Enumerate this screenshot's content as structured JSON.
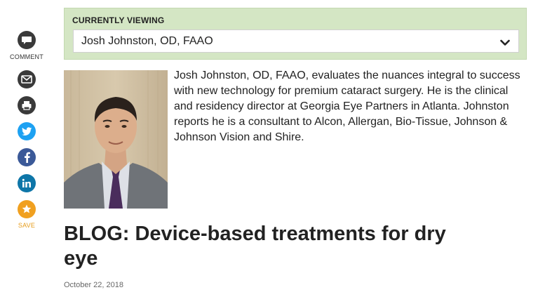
{
  "share_rail": {
    "comment_label": "COMMENT",
    "save_label": "SAVE",
    "icons": [
      "comment-icon",
      "email-icon",
      "print-icon",
      "twitter-icon",
      "facebook-icon",
      "linkedin-icon",
      "star-icon"
    ],
    "colors": {
      "dark": "#3a3a3a",
      "twitter": "#1da1f2",
      "facebook": "#3b5998",
      "linkedin": "#0e76a8",
      "save": "#f0a020"
    }
  },
  "currently_viewing": {
    "label": "CURRENTLY VIEWING",
    "selected": "Josh Johnston, OD, FAAO",
    "panel_color": "#d4e6c4"
  },
  "author": {
    "bio": "Josh Johnston, OD, FAAO, evaluates the nuances integral to success with new technology for premium cataract surgery. He is the clinical and residency director at Georgia Eye Partners in Atlanta. Johnston reports he is a consultant to Alcon, Allergan, Bio-Tissue, Johnson & Johnson Vision and Shire."
  },
  "article": {
    "title": "BLOG: Device-based treatments for dry eye",
    "date": "October 22, 2018"
  }
}
